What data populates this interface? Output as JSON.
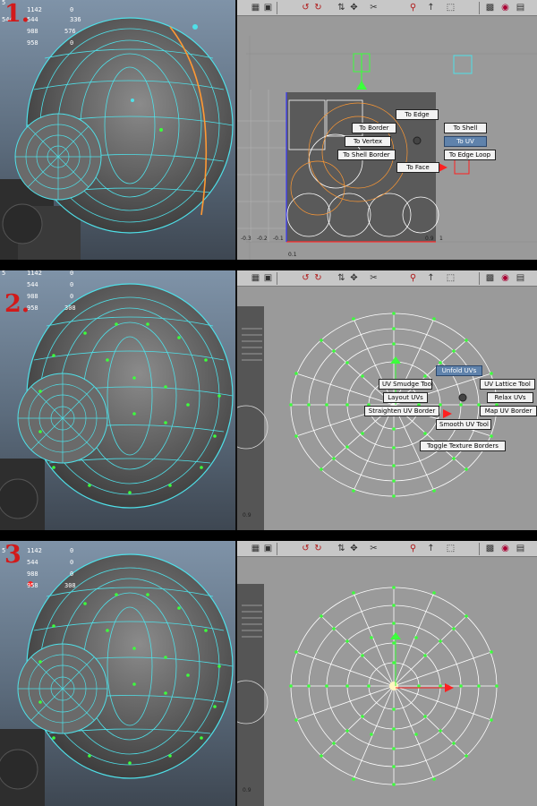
{
  "steps": [
    {
      "label": "1.",
      "hud": [
        "5",
        "1142",
        "544",
        "988",
        "958"
      ],
      "hud2": [
        "0",
        "0",
        "336",
        "576",
        "0"
      ],
      "marking_menu": [
        "To Edge",
        "To Border",
        "To Shell",
        "To Vertex",
        "To UV",
        "To Shell Border",
        "To Edge Loop",
        "To Face"
      ],
      "axis_labels": [
        "-0.3",
        "-0.2",
        "-0.1",
        "0.9",
        "1",
        "0.1"
      ]
    },
    {
      "label": "2.",
      "hud": [
        "5",
        "1142",
        "544",
        "988",
        "958"
      ],
      "hud2": [
        "0",
        "0",
        "0",
        "0",
        "308"
      ],
      "marking_menu": [
        "Unfold UVs",
        "UV Lattice Tool",
        "UV Smudge Tool",
        "Relax UVs",
        "Layout UVs",
        "Map UV Border",
        "Straighten UV Border",
        "Smooth UV Tool",
        "Toggle Texture Borders"
      ],
      "axis_labels": [
        "0.9"
      ]
    },
    {
      "label": "3",
      "hud": [
        "5",
        "1142",
        "544",
        "988",
        "958"
      ],
      "hud2": [
        "0",
        "0",
        "0",
        "0",
        "308"
      ],
      "axis_labels": [
        "0.9"
      ]
    }
  ],
  "colors": {
    "wire_selected": "#4fe0e8",
    "uv_point": "#3cff3c",
    "step_label": "#d21a1a",
    "menu_highlight": "#5f82ab"
  },
  "toolbar_icons": [
    "grid-icon",
    "image-icon",
    "rotate-ccw-icon",
    "rotate-cw-icon",
    "flip-icon",
    "move-icon",
    "cut-icon",
    "sew-icon",
    "pin-icon",
    "unpin-icon",
    "checker-icon",
    "color-icon"
  ]
}
